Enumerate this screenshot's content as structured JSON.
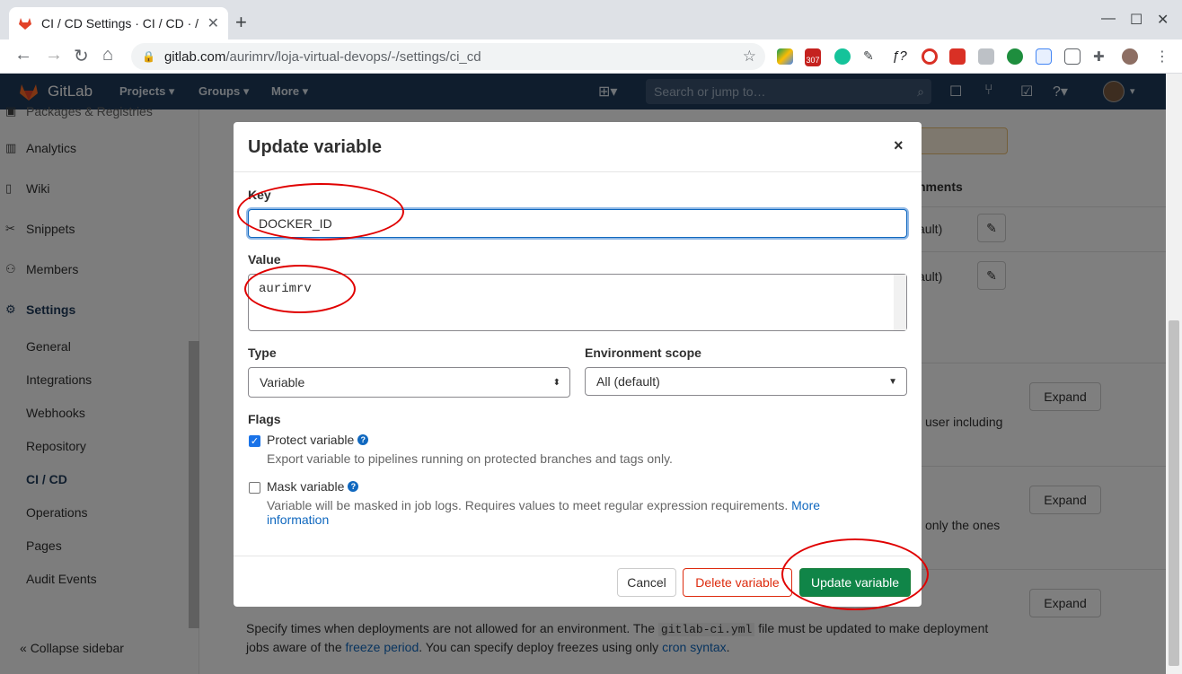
{
  "browser": {
    "tab_title": "CI / CD Settings · CI / CD · /",
    "url_domain": "gitlab.com",
    "url_path": "/aurimrv/loja-virtual-devops/-/settings/ci_cd",
    "ext_badge": "307"
  },
  "gitlab": {
    "brand": "GitLab",
    "menu": [
      "Projects",
      "Groups",
      "More"
    ],
    "search_placeholder": "Search or jump to…"
  },
  "sidebar": {
    "top_cut": "Packages & Registries",
    "items": [
      {
        "label": "Analytics",
        "icon": "chart-icon"
      },
      {
        "label": "Wiki",
        "icon": "book-icon"
      },
      {
        "label": "Snippets",
        "icon": "scissors-icon"
      },
      {
        "label": "Members",
        "icon": "users-icon"
      },
      {
        "label": "Settings",
        "icon": "gear-icon"
      }
    ],
    "sub_items": [
      "General",
      "Integrations",
      "Webhooks",
      "Repository",
      "CI / CD",
      "Operations",
      "Pages",
      "Audit Events"
    ],
    "collapse": "Collapse sidebar"
  },
  "background": {
    "environments_header": "nments",
    "scope_1": "ault)",
    "scope_2": "ault)",
    "expand_1": "Expand",
    "expand_2": "Expand",
    "expand_3": "Expand",
    "cut_text_1": "user including",
    "cut_text_2": "only the ones",
    "deploy_freeze_text_1": "Specify times when deployments are not allowed for an environment. The",
    "deploy_freeze_code": "gitlab-ci.yml",
    "deploy_freeze_text_2": "file must be updated to make deployment",
    "deploy_freeze_text_3": "jobs aware of the",
    "freeze_link": "freeze period",
    "deploy_freeze_text_4": ". You can specify deploy freezes using only",
    "cron_link": "cron syntax",
    "deploy_freeze_text_5": "."
  },
  "modal": {
    "title": "Update variable",
    "close": "×",
    "key_label": "Key",
    "key_value": "DOCKER_ID",
    "value_label": "Value",
    "value_value": "aurimrv",
    "type_label": "Type",
    "type_value": "Variable",
    "env_label": "Environment scope",
    "env_value": "All (default)",
    "flags_label": "Flags",
    "protect_label": "Protect variable",
    "protect_checked": true,
    "protect_help": "Export variable to pipelines running on protected branches and tags only.",
    "mask_label": "Mask variable",
    "mask_checked": false,
    "mask_help": "Variable will be masked in job logs. Requires values to meet regular expression requirements.",
    "mask_link_1": "More",
    "mask_link_2": "information",
    "cancel": "Cancel",
    "delete": "Delete variable",
    "update": "Update variable"
  },
  "colors": {
    "header_bg": "#1f3b5a",
    "primary_green": "#108548",
    "danger_red": "#dd2b0e",
    "annotation_red": "#e00000",
    "link_blue": "#1068bf"
  }
}
